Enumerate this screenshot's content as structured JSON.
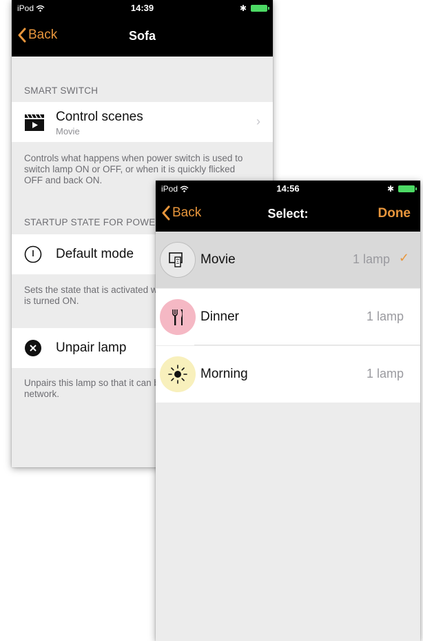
{
  "screen1": {
    "status": {
      "carrier": "iPod",
      "time": "14:39"
    },
    "nav": {
      "back": "Back",
      "title": "Sofa"
    },
    "smart_switch": {
      "header": "SMART SWITCH",
      "cell_title": "Control scenes",
      "cell_subtitle": "Movie",
      "footer": "Controls what happens when power switch is used to switch lamp ON or OFF, or when it is quickly flicked OFF and back ON."
    },
    "startup": {
      "header": "STARTUP STATE FOR POWER SWITCH",
      "cell_title": "Default mode",
      "footer": "Sets the state that is activated when the power switch is turned ON."
    },
    "unpair": {
      "cell_title": "Unpair lamp",
      "footer": "Unpairs this lamp so that it can be added to another network."
    }
  },
  "screen2": {
    "status": {
      "carrier": "iPod",
      "time": "14:56"
    },
    "nav": {
      "back": "Back",
      "title": "Select:",
      "done": "Done"
    },
    "scenes": [
      {
        "name": "Movie",
        "count": "1 lamp",
        "selected": true,
        "icon": "remote-icon",
        "color": "#e8e8e8"
      },
      {
        "name": "Dinner",
        "count": "1 lamp",
        "selected": false,
        "icon": "fork-knife-icon",
        "color": "#f5b8c4"
      },
      {
        "name": "Morning",
        "count": "1 lamp",
        "selected": false,
        "icon": "sun-icon",
        "color": "#f8f0bc"
      }
    ],
    "check_glyph": "✓"
  },
  "colors": {
    "accent": "#e8963c",
    "navbar": "#000000",
    "background": "#ececec"
  }
}
